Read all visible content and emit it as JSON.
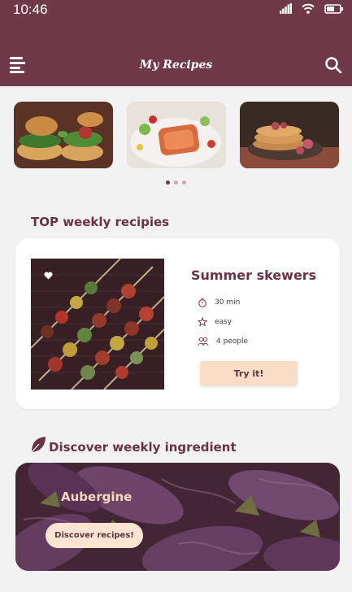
{
  "status_bar": {
    "time": "10:46"
  },
  "app_bar": {
    "title": "My Recipes",
    "menu_icon": "menu-icon",
    "search_icon": "search-icon"
  },
  "carousel": {
    "items": [
      {
        "name": "burger-image"
      },
      {
        "name": "salmon-image"
      },
      {
        "name": "pancakes-image"
      }
    ],
    "active_index": 0,
    "page_count": 3
  },
  "top_weekly": {
    "section_title": "TOP weekly recipies",
    "recipe": {
      "name": "Summer skewers",
      "time": "30 min",
      "difficulty": "easy",
      "people": "4 people",
      "try_label": "Try it!"
    }
  },
  "ingredient": {
    "section_title": "Discover weekly ingredient",
    "name": "Aubergine",
    "button_label": "Discover recipes!"
  },
  "colors": {
    "primary": "#70394a",
    "accent_button": "#fbdcc4",
    "background": "#f2f2f2"
  }
}
